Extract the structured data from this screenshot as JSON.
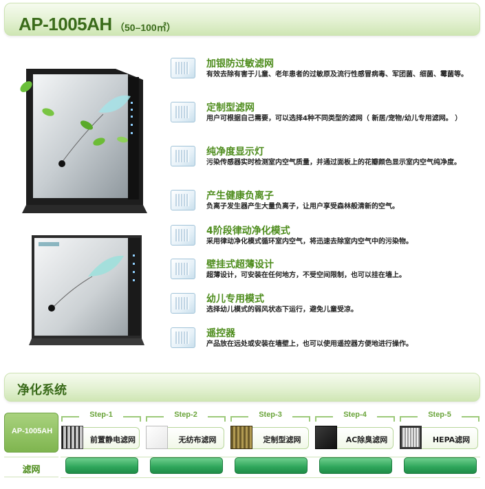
{
  "header": {
    "title": "AP-1005AH",
    "subtitle": "（50–100㎡）"
  },
  "features": [
    {
      "icon": "filter-panel-icon",
      "title": "加银防过敏滤网",
      "desc": "有效去除有害于儿童、老年患者的过敏原及流行性感冒病毒、军团菌、细菌、霉菌等。"
    },
    {
      "icon": "custom-filter-icon",
      "title": "定制型滤网",
      "desc": "用户可根据自己需要，可以选择4种不同类型的滤网（ 新居/宠物/幼儿专用滤网。 ）"
    },
    {
      "icon": "purity-light-icon",
      "title": "纯净度显示灯",
      "desc": "污染传感器实时检测室内空气质量，并通过面板上的花瓣颜色显示室内空气纯净度。"
    },
    {
      "icon": "negative-ion-icon",
      "title": "产生健康负离子",
      "desc": "负离子发生器产生大量负离子，让用户享受森林般清新的空气。"
    },
    {
      "icon": "four-stage-mode-icon",
      "title": "4阶段律动净化模式",
      "desc": "采用律动净化模式循环室内空气，将迅速去除室内空气中的污染物。"
    },
    {
      "icon": "wall-mount-icon",
      "title": "壁挂式超薄设计",
      "desc": "超薄设计，可安装在任何地方，不受空间限制，也可以挂在墙上。"
    },
    {
      "icon": "child-mode-icon",
      "title": "幼儿专用模式",
      "desc": "选择幼儿模式的弱风状态下运行，避免儿童受凉。"
    },
    {
      "icon": "remote-control-icon",
      "title": "遥控器",
      "desc": "产品放在远处或安装在墙壁上，也可以使用遥控器方便地进行操作。"
    }
  ],
  "section": {
    "title": "净化系统"
  },
  "table": {
    "model": "AP-1005AH",
    "row_label": "滤网",
    "steps": [
      {
        "label": "Step-1",
        "name": "前置静电滤网",
        "thumb": "grid"
      },
      {
        "label": "Step-2",
        "name": "无纺布滤网",
        "thumb": "white"
      },
      {
        "label": "Step-3",
        "name": "定制型滤网",
        "thumb": "brown"
      },
      {
        "label": "Step-4",
        "name": "AC除臭滤网",
        "thumb": "black"
      },
      {
        "label": "Step-5",
        "name": "HEPA滤网",
        "thumb": "hepa"
      }
    ]
  },
  "colors": {
    "accent_green": "#4d8c1c",
    "bar_green": "#2ea55a"
  }
}
